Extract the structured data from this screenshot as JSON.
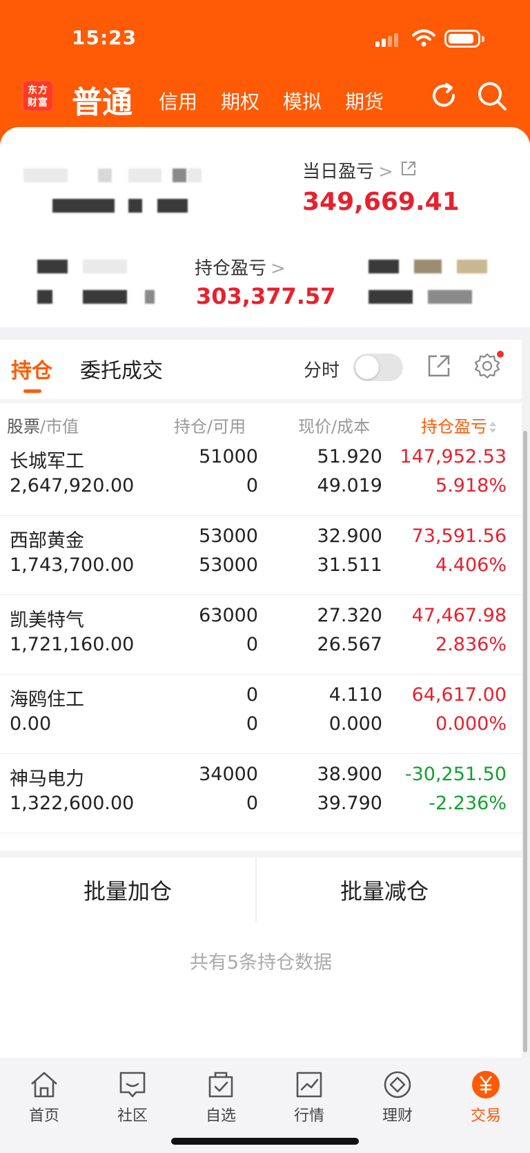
{
  "status_bar": {
    "time": "15:23"
  },
  "header": {
    "logo_text": "东方财富",
    "main_tab": "普通",
    "tabs": [
      "信用",
      "期权",
      "模拟",
      "期货"
    ]
  },
  "account": {
    "daily_pl_label": "当日盈亏",
    "daily_pl_value": "349,669.41",
    "holding_pl_label": "持仓盈亏",
    "holding_pl_value": "303,377.57",
    "chevron": ">"
  },
  "positions": {
    "tab_holdings": "持仓",
    "tab_orders": "委托成交",
    "fenshi_label": "分时",
    "columns": {
      "stock": "股票",
      "market_value": "市值",
      "holding": "持仓",
      "available": "可用",
      "price": "现价",
      "cost": "成本",
      "pl": "持仓盈亏",
      "sep": "/"
    },
    "rows": [
      {
        "name": "长城军工",
        "market_value": "2,647,920.00",
        "qty": "51000",
        "available": "0",
        "price": "51.920",
        "cost": "49.019",
        "pl": "147,952.53",
        "pl_pct": "5.918%",
        "dir": "up"
      },
      {
        "name": "西部黄金",
        "market_value": "1,743,700.00",
        "qty": "53000",
        "available": "53000",
        "price": "32.900",
        "cost": "31.511",
        "pl": "73,591.56",
        "pl_pct": "4.406%",
        "dir": "up"
      },
      {
        "name": "凯美特气",
        "market_value": "1,721,160.00",
        "qty": "63000",
        "available": "0",
        "price": "27.320",
        "cost": "26.567",
        "pl": "47,467.98",
        "pl_pct": "2.836%",
        "dir": "up"
      },
      {
        "name": "海鸥住工",
        "market_value": "0.00",
        "qty": "0",
        "available": "0",
        "price": "4.110",
        "cost": "0.000",
        "pl": "64,617.00",
        "pl_pct": "0.000%",
        "dir": "up"
      },
      {
        "name": "神马电力",
        "market_value": "1,322,600.00",
        "qty": "34000",
        "available": "0",
        "price": "38.900",
        "cost": "39.790",
        "pl": "-30,251.50",
        "pl_pct": "-2.236%",
        "dir": "down"
      }
    ],
    "batch_add": "批量加仓",
    "batch_reduce": "批量减仓",
    "footer": "共有5条持仓数据"
  },
  "bottom_nav": [
    {
      "label": "首页",
      "icon": "home-icon"
    },
    {
      "label": "社区",
      "icon": "community-icon"
    },
    {
      "label": "自选",
      "icon": "watchlist-icon"
    },
    {
      "label": "行情",
      "icon": "market-icon"
    },
    {
      "label": "理财",
      "icon": "wealth-icon"
    },
    {
      "label": "交易",
      "icon": "trade-icon",
      "active": true
    }
  ],
  "colors": {
    "brand": "#ff5a05",
    "up": "#e8202d",
    "down": "#10a030"
  }
}
